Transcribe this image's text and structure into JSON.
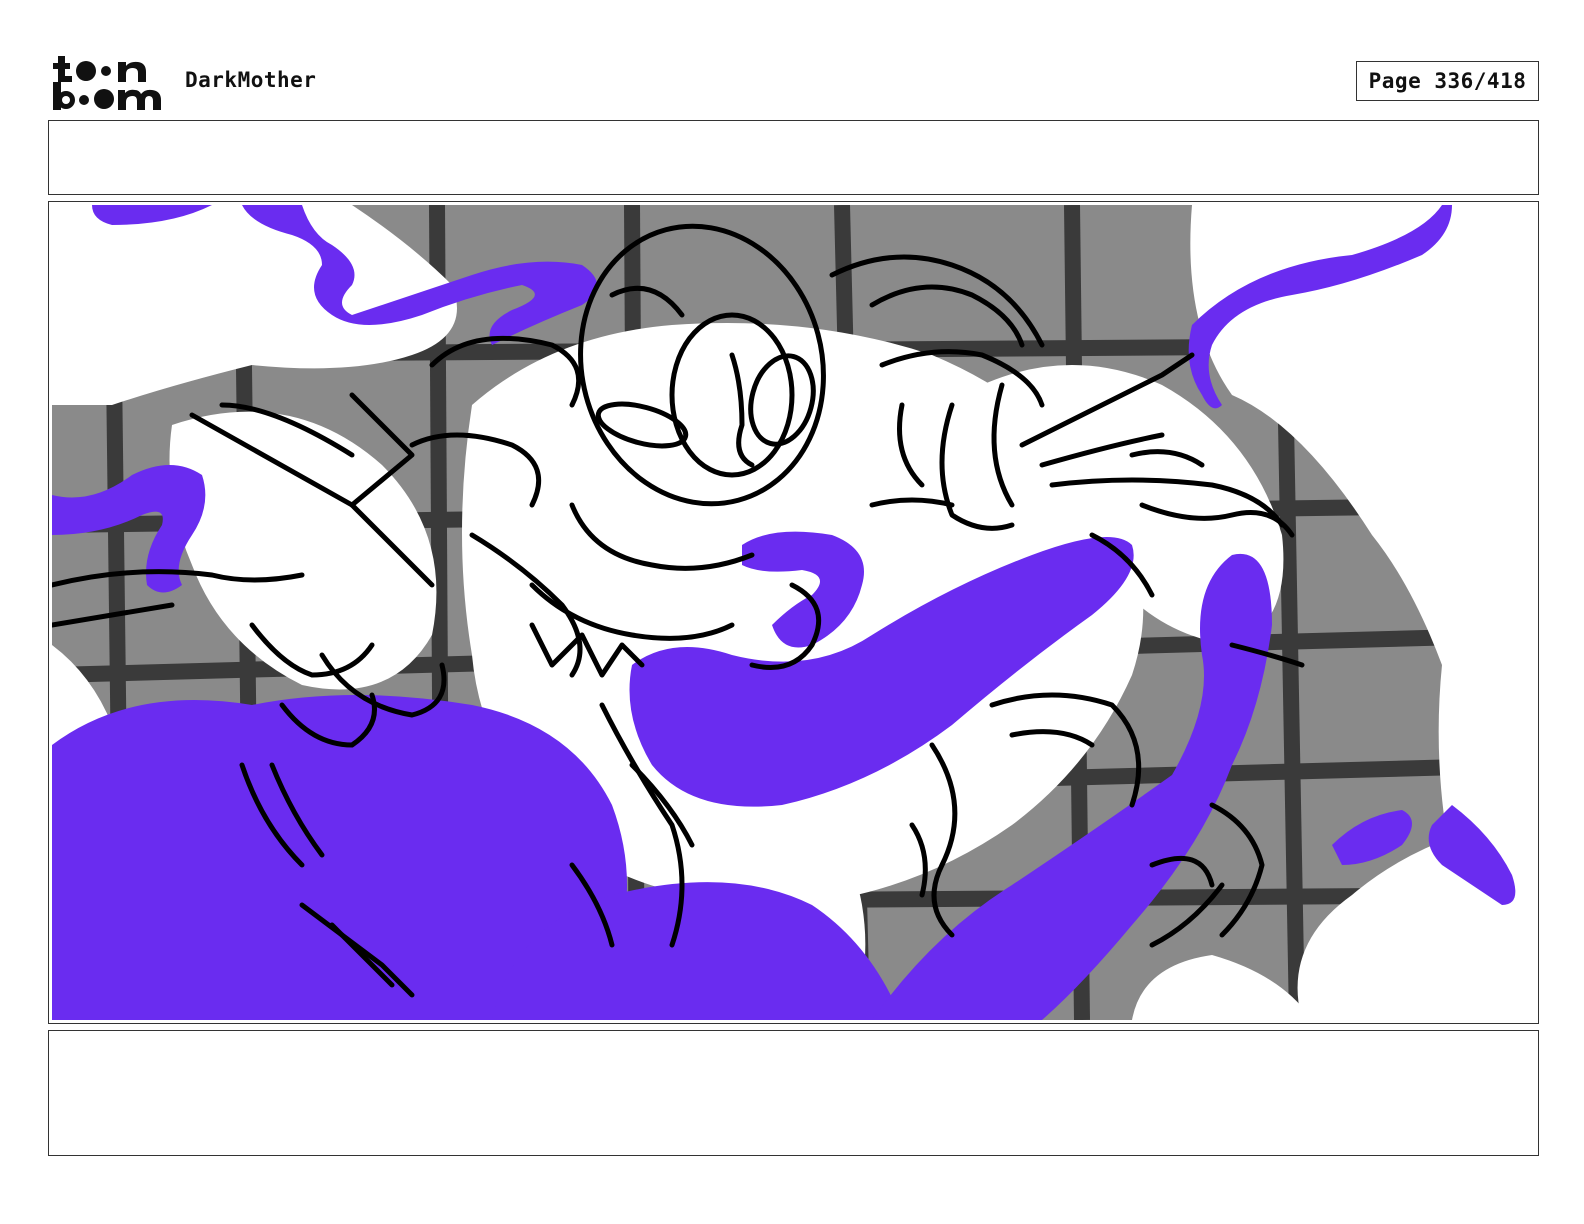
{
  "header": {
    "logo_top": "t●●n",
    "logo_bottom": "b●●m",
    "project_title": "DarkMother",
    "page_counter": "Page 336/418"
  },
  "panel": {
    "notes": "",
    "caption": "",
    "colors": {
      "purple": "#6a2cf0",
      "grid_dark": "#3a3a3a",
      "grid_mid": "#8a8a8a",
      "ink": "#000000",
      "paper": "#ffffff"
    }
  }
}
